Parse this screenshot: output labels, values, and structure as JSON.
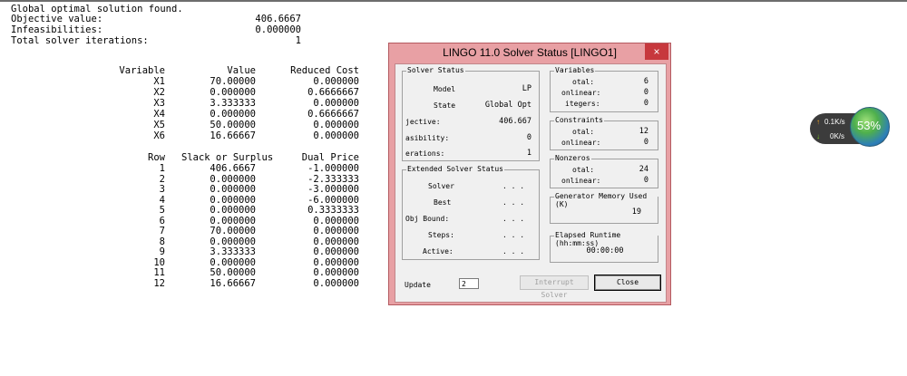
{
  "report": {
    "header": {
      "line1": "Global optimal solution found.",
      "objective_label": "Objective value:",
      "objective_value": "406.6667",
      "infeas_label": "Infeasibilities:",
      "infeas_value": "0.000000",
      "iter_label": "Total solver iterations:",
      "iter_value": "1"
    },
    "var_headers": [
      "Variable",
      "Value",
      "Reduced Cost"
    ],
    "variables": [
      [
        "X1",
        "70.00000",
        "0.000000"
      ],
      [
        "X2",
        "0.000000",
        "0.6666667"
      ],
      [
        "X3",
        "3.333333",
        "0.000000"
      ],
      [
        "X4",
        "0.000000",
        "0.6666667"
      ],
      [
        "X5",
        "50.00000",
        "0.000000"
      ],
      [
        "X6",
        "16.66667",
        "0.000000"
      ]
    ],
    "row_headers": [
      "Row",
      "Slack or Surplus",
      "Dual Price"
    ],
    "rows": [
      [
        "1",
        "406.6667",
        "-1.000000"
      ],
      [
        "2",
        "0.000000",
        "-2.333333"
      ],
      [
        "3",
        "0.000000",
        "-3.000000"
      ],
      [
        "4",
        "0.000000",
        "-6.000000"
      ],
      [
        "5",
        "0.000000",
        "0.3333333"
      ],
      [
        "6",
        "0.000000",
        "0.000000"
      ],
      [
        "7",
        "70.00000",
        "0.000000"
      ],
      [
        "8",
        "0.000000",
        "0.000000"
      ],
      [
        "9",
        "3.333333",
        "0.000000"
      ],
      [
        "10",
        "0.000000",
        "0.000000"
      ],
      [
        "11",
        "50.00000",
        "0.000000"
      ],
      [
        "12",
        "16.66667",
        "0.000000"
      ]
    ]
  },
  "dialog": {
    "title": "LINGO 11.0 Solver Status [LINGO1]",
    "close_glyph": "×",
    "solver_status": {
      "label": "Solver Status",
      "model_label": "Model",
      "model_value": "LP",
      "state_label": "State",
      "state_value": "Global Opt",
      "objective_label": "jective:",
      "objective_value": "406.667",
      "infeas_label": "asibility:",
      "infeas_value": "0",
      "iter_label": "erations:",
      "iter_value": "1"
    },
    "extended": {
      "label": "Extended Solver Status",
      "solver_label": "Solver",
      "best_label": "Best",
      "bound_label": "Obj Bound:",
      "steps_label": "Steps:",
      "active_label": "Active:",
      "blank": ". . ."
    },
    "variables": {
      "label": "Variables",
      "total_label": "otal:",
      "total_value": "6",
      "nonlinear_label": "onlinear:",
      "nonlinear_value": "0",
      "integers_label": "itegers:",
      "integers_value": "0"
    },
    "constraints": {
      "label": "Constraints",
      "total_label": "otal:",
      "total_value": "12",
      "nonlinear_label": "onlinear:",
      "nonlinear_value": "0"
    },
    "nonzeros": {
      "label": "Nonzeros",
      "total_label": "otal:",
      "total_value": "24",
      "nonlinear_label": "onlinear:",
      "nonlinear_value": "0"
    },
    "memory": {
      "label": "Generator Memory Used (K)",
      "value": "19"
    },
    "runtime": {
      "label": "Elapsed Runtime (hh:mm:ss)",
      "value": "00:00:00"
    },
    "update_label": "Update",
    "update_value": "2",
    "interrupt_label": "Interrupt Solver",
    "close_label": "Close"
  },
  "net_widget": {
    "up_arrow": "↑",
    "up_rate": "0.1K/s",
    "down_arrow": "↓",
    "down_rate": "0K/s",
    "percent": "53%"
  }
}
